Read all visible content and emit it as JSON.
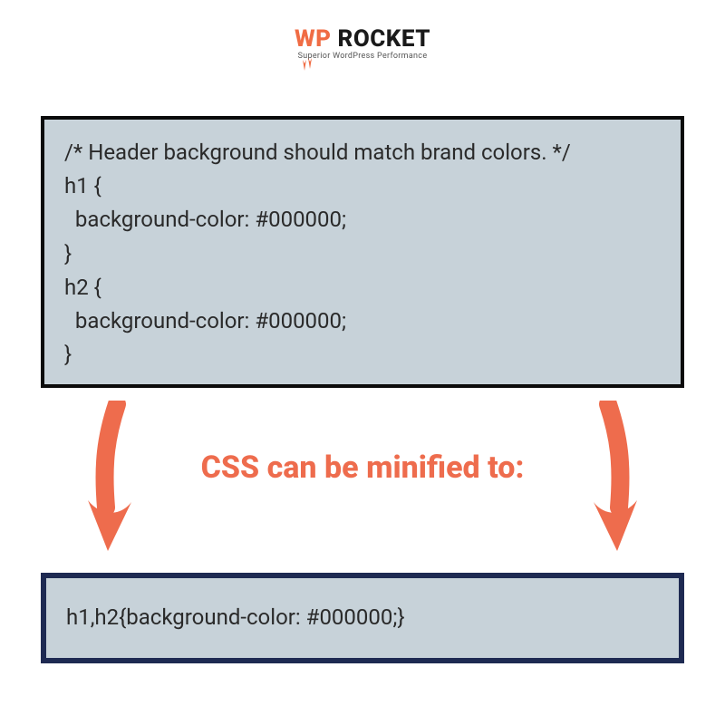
{
  "brand": {
    "name_part1": "WP",
    "name_part2": " ROCKET",
    "tagline": "Superior WordPress Performance",
    "accent_color": "#f06c44",
    "dark_color": "#1a1a1a"
  },
  "code_before": "/* Header background should match brand colors. */\nh1 {\n  background-color: #000000;\n}\nh2 {\n  background-color: #000000;\n}",
  "caption": "CSS can be minified to:",
  "code_after": "h1,h2{background-color: #000000;}",
  "colors": {
    "box_bg": "#c7d2d9",
    "box_border_top": "#0b0b0b",
    "box_border_bottom": "#1e2a52",
    "arrow": "#ee6c4d"
  }
}
